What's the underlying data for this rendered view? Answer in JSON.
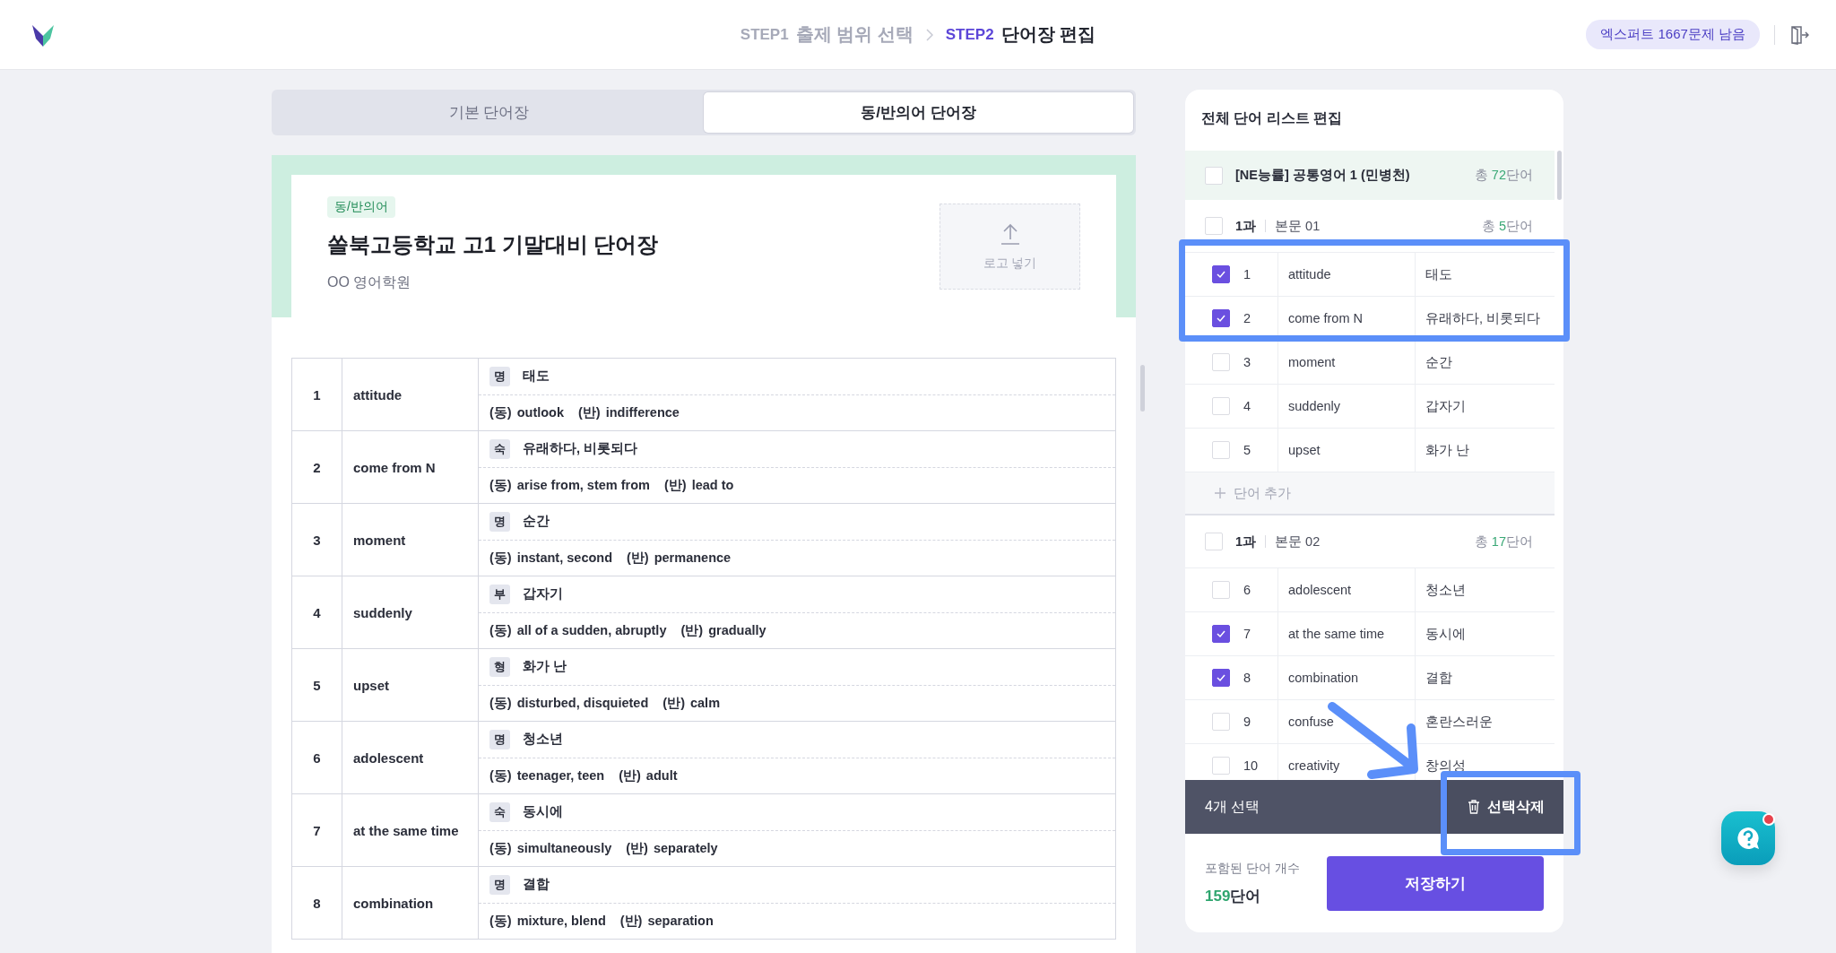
{
  "header": {
    "steps": [
      {
        "step": "STEP1",
        "label": "출제 범위 선택",
        "selected": false
      },
      {
        "step": "STEP2",
        "label": "단어장 편집",
        "selected": true
      }
    ],
    "quota_badge": "엑스퍼트 1667문제 남음"
  },
  "tabs": [
    {
      "label": "기본 단어장",
      "selected": false
    },
    {
      "label": "동/반의어 단어장",
      "selected": true
    }
  ],
  "preview": {
    "tag": "동/반의어",
    "title": "쏠북고등학교 고1 기말대비 단어장",
    "subtitle": "OO 영어학원",
    "logo_upload": "로고 넣기",
    "rows": [
      {
        "no": "1",
        "word": "attitude",
        "pos": "명",
        "meaning": "태도",
        "syn_label": "(동)",
        "synonyms": "outlook",
        "ant_label": "(반)",
        "antonyms": "indifference"
      },
      {
        "no": "2",
        "word": "come from N",
        "pos": "숙",
        "meaning": "유래하다, 비롯되다",
        "syn_label": "(동)",
        "synonyms": "arise from, stem from",
        "ant_label": "(반)",
        "antonyms": "lead to"
      },
      {
        "no": "3",
        "word": "moment",
        "pos": "명",
        "meaning": "순간",
        "syn_label": "(동)",
        "synonyms": "instant, second",
        "ant_label": "(반)",
        "antonyms": "permanence"
      },
      {
        "no": "4",
        "word": "suddenly",
        "pos": "부",
        "meaning": "갑자기",
        "syn_label": "(동)",
        "synonyms": "all of a sudden, abruptly",
        "ant_label": "(반)",
        "antonyms": "gradually"
      },
      {
        "no": "5",
        "word": "upset",
        "pos": "형",
        "meaning": "화가 난",
        "syn_label": "(동)",
        "synonyms": "disturbed, disquieted",
        "ant_label": "(반)",
        "antonyms": "calm"
      },
      {
        "no": "6",
        "word": "adolescent",
        "pos": "명",
        "meaning": "청소년",
        "syn_label": "(동)",
        "synonyms": "teenager, teen",
        "ant_label": "(반)",
        "antonyms": "adult"
      },
      {
        "no": "7",
        "word": "at the same time",
        "pos": "숙",
        "meaning": "동시에",
        "syn_label": "(동)",
        "synonyms": "simultaneously",
        "ant_label": "(반)",
        "antonyms": "separately"
      },
      {
        "no": "8",
        "word": "combination",
        "pos": "명",
        "meaning": "결합",
        "syn_label": "(동)",
        "synonyms": "mixture, blend",
        "ant_label": "(반)",
        "antonyms": "separation"
      }
    ]
  },
  "word_list": {
    "title": "전체 단어 리스트 편집",
    "book": {
      "title": "[NE능률] 공통영어 1 (민병천)",
      "total_prefix": "총",
      "total_count": "72",
      "total_unit": "단어",
      "checked": false
    },
    "lessons": [
      {
        "unit": "1과",
        "section": "본문 01",
        "total_prefix": "총",
        "total_count": "5",
        "total_unit": "단어",
        "checked": false,
        "add_label": "단어 추가",
        "words": [
          {
            "no": "1",
            "word": "attitude",
            "meaning": "태도",
            "checked": true
          },
          {
            "no": "2",
            "word": "come from N",
            "meaning": "유래하다, 비롯되다",
            "checked": true
          },
          {
            "no": "3",
            "word": "moment",
            "meaning": "순간",
            "checked": false
          },
          {
            "no": "4",
            "word": "suddenly",
            "meaning": "갑자기",
            "checked": false
          },
          {
            "no": "5",
            "word": "upset",
            "meaning": "화가 난",
            "checked": false
          }
        ]
      },
      {
        "unit": "1과",
        "section": "본문 02",
        "total_prefix": "총",
        "total_count": "17",
        "total_unit": "단어",
        "checked": false,
        "words": [
          {
            "no": "6",
            "word": "adolescent",
            "meaning": "청소년",
            "checked": false
          },
          {
            "no": "7",
            "word": "at the same time",
            "meaning": "동시에",
            "checked": true
          },
          {
            "no": "8",
            "word": "combination",
            "meaning": "결합",
            "checked": true
          },
          {
            "no": "9",
            "word": "confuse",
            "meaning": "혼란스러운",
            "checked": false
          },
          {
            "no": "10",
            "word": "creativity",
            "meaning": "창의성",
            "checked": false
          }
        ]
      }
    ],
    "selection_bar": {
      "count": "4개 선택",
      "delete": "선택삭제"
    },
    "footer": {
      "label": "포함된 단어 개수",
      "count": "159",
      "unit": "단어",
      "save": "저장하기"
    }
  }
}
